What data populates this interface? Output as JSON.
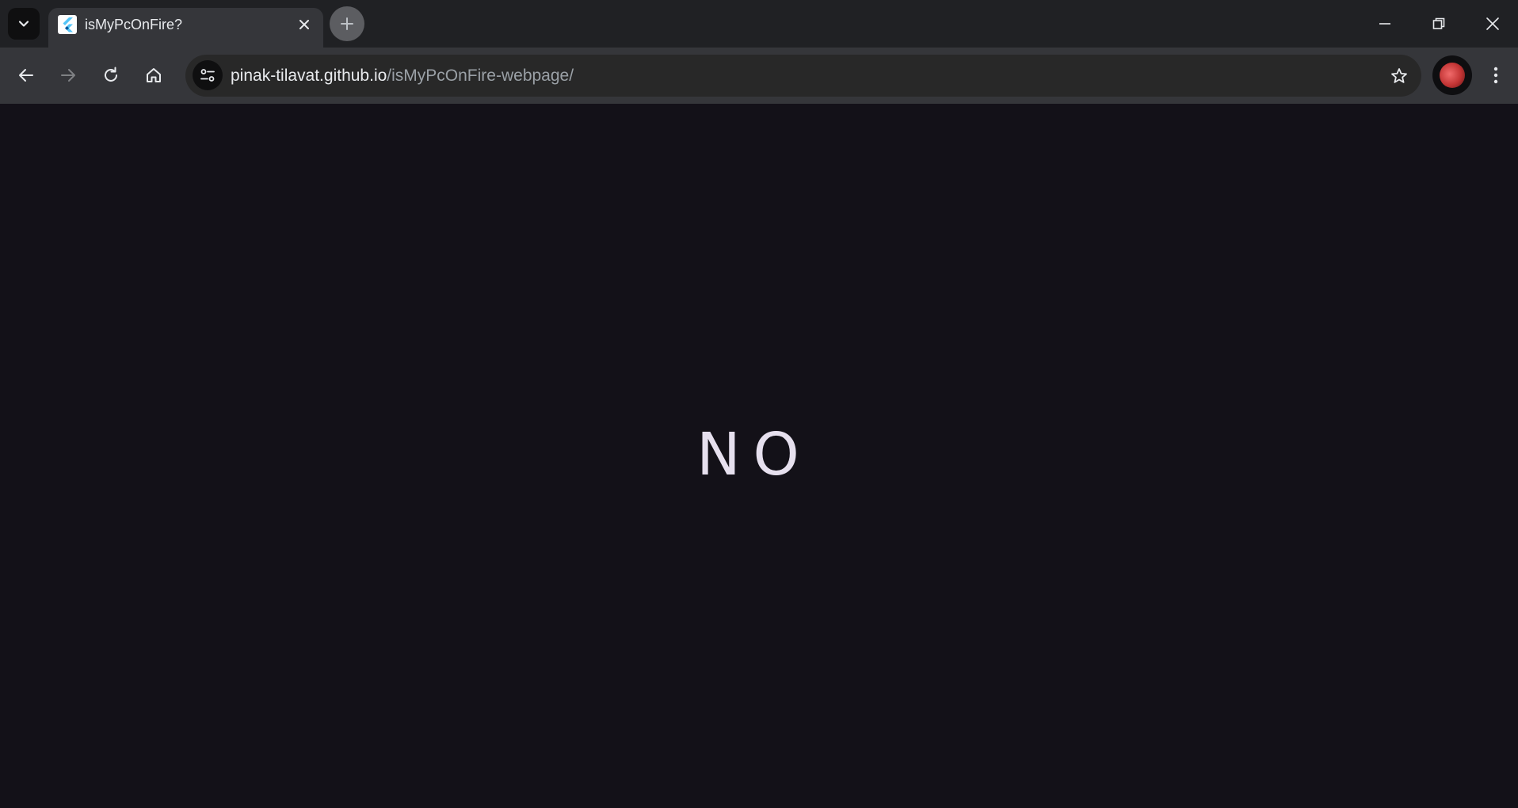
{
  "browser": {
    "tab": {
      "title": "isMyPcOnFire?",
      "favicon": "flutter-logo-icon"
    },
    "address_bar": {
      "host": "pinak-tilavat.github.io",
      "path": "/isMyPcOnFire-webpage/"
    },
    "icons": {
      "tab_search": "chevron-down-icon",
      "close_tab": "close-icon",
      "new_tab": "plus-icon",
      "back": "arrow-left-icon",
      "forward": "arrow-right-icon",
      "reload": "reload-icon",
      "home": "home-icon",
      "site_info": "tune-icon",
      "bookmark": "star-icon",
      "menu": "kebab-menu-icon",
      "minimize": "minimize-icon",
      "restore": "restore-icon",
      "close_window": "close-icon"
    }
  },
  "page": {
    "answer": "NO",
    "background": "#131118",
    "text_color": "#e6e0ee"
  }
}
